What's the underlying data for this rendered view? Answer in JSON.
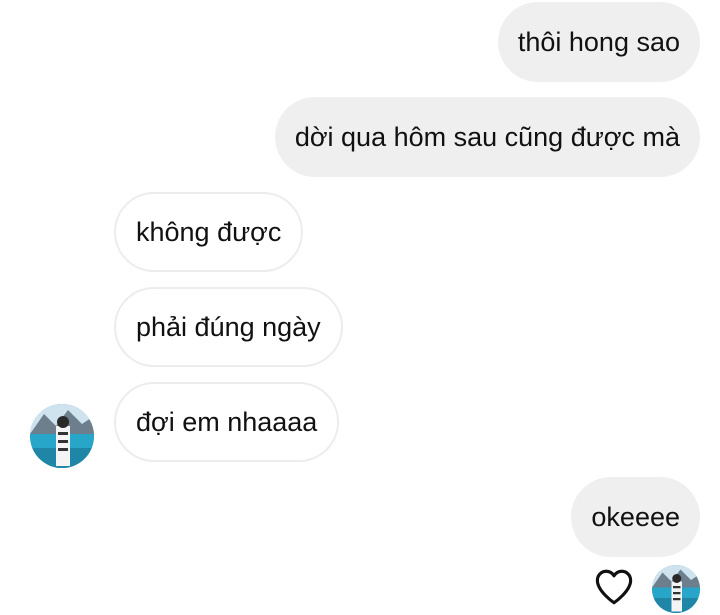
{
  "messages": [
    {
      "direction": "sent",
      "text": "thôi hong sao"
    },
    {
      "direction": "sent",
      "text": "dời qua hôm sau cũng được mà"
    },
    {
      "direction": "received",
      "text": "không được"
    },
    {
      "direction": "received",
      "text": "phải đúng ngày"
    },
    {
      "direction": "received",
      "text": "đợi em nhaaaa"
    },
    {
      "direction": "sent",
      "text": "okeeee"
    }
  ],
  "icons": {
    "like": "heart-outline-icon",
    "contact_avatar": "avatar-photo",
    "seen_avatar": "avatar-photo-small"
  },
  "colors": {
    "sent_bubble": "#efefef",
    "received_border": "#ececec",
    "text": "#111111",
    "background": "#ffffff"
  }
}
